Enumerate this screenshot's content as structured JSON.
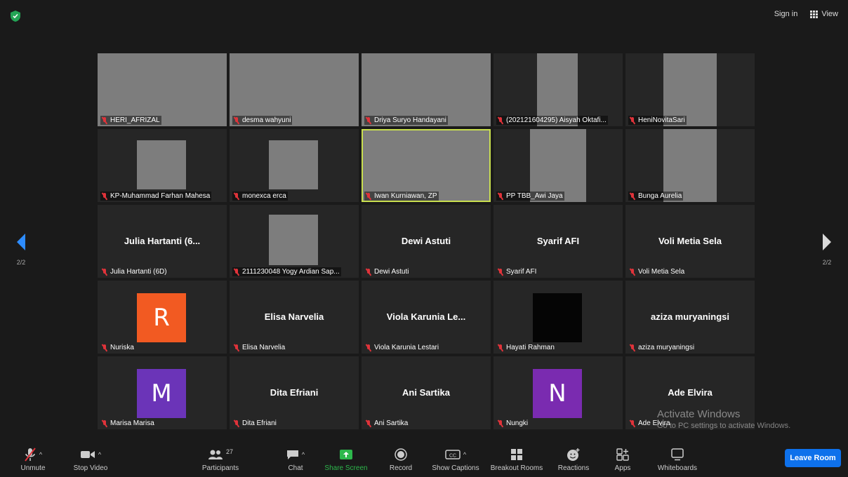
{
  "header": {
    "sign_in": "Sign in",
    "view": "View"
  },
  "pager": {
    "left": "2/2",
    "right": "2/2"
  },
  "tiles": [
    {
      "name": "HERI_AFRIZAL",
      "video": true
    },
    {
      "name": "desma wahyuni",
      "video": true
    },
    {
      "name": "Driya Suryo Handayani",
      "video": true
    },
    {
      "name": "(202121604295) Aisyah Oktafi...",
      "video": true
    },
    {
      "name": "HeniNovitaSari",
      "video": true
    },
    {
      "name": "KP-Muhammad Farhan Mahesa",
      "video": true
    },
    {
      "name": "monexca erca",
      "video": true
    },
    {
      "name": "Iwan Kurniawan, ZP",
      "video": true,
      "active": true
    },
    {
      "name": "PP TBB_Awi Jaya",
      "video": true
    },
    {
      "name": "Bunga Aurelia",
      "video": true
    },
    {
      "name": "Julia Hartanti (6D)",
      "display_name": "Julia Hartanti (6..."
    },
    {
      "name": "2111230048 Yogy Ardian Sap...",
      "video": true
    },
    {
      "name": "Dewi Astuti",
      "display_name": "Dewi Astuti"
    },
    {
      "name": "Syarif AFI",
      "display_name": "Syarif AFI"
    },
    {
      "name": "Voli Metia Sela",
      "display_name": "Voli Metia Sela"
    },
    {
      "name": "Nuriska",
      "avatar": "R",
      "avatar_color": "#f25a22"
    },
    {
      "name": "Elisa Narvelia",
      "display_name": "Elisa Narvelia"
    },
    {
      "name": "Viola Karunia Lestari",
      "display_name": "Viola Karunia Le..."
    },
    {
      "name": "Hayati Rahman",
      "avatar": "",
      "avatar_color": "#050505"
    },
    {
      "name": "aziza muryaningsi",
      "display_name": "aziza muryaningsi"
    },
    {
      "name": "Marisa Marisa",
      "avatar": "M",
      "avatar_color": "#6b34b8"
    },
    {
      "name": "Dita Efriani",
      "display_name": "Dita Efriani"
    },
    {
      "name": "Ani Sartika",
      "display_name": "Ani Sartika"
    },
    {
      "name": "Nungki",
      "avatar": "N",
      "avatar_color": "#7a2bb0"
    },
    {
      "name": "Ade Elvira",
      "display_name": "Ade Elvira"
    }
  ],
  "watermark": {
    "title": "Activate Windows",
    "subtitle": "Go to PC settings to activate Windows."
  },
  "toolbar": {
    "unmute": "Unmute",
    "stop_video": "Stop Video",
    "participants": "Participants",
    "participants_count": "27",
    "chat": "Chat",
    "share_screen": "Share Screen",
    "record": "Record",
    "show_captions": "Show Captions",
    "breakout_rooms": "Breakout Rooms",
    "reactions": "Reactions",
    "apps": "Apps",
    "whiteboards": "Whiteboards",
    "leave_room": "Leave Room"
  },
  "colors": {
    "accent": "#0e71eb",
    "share_green": "#2db84c",
    "muted_red": "#e0333a",
    "active_border": "#c9df4f"
  }
}
